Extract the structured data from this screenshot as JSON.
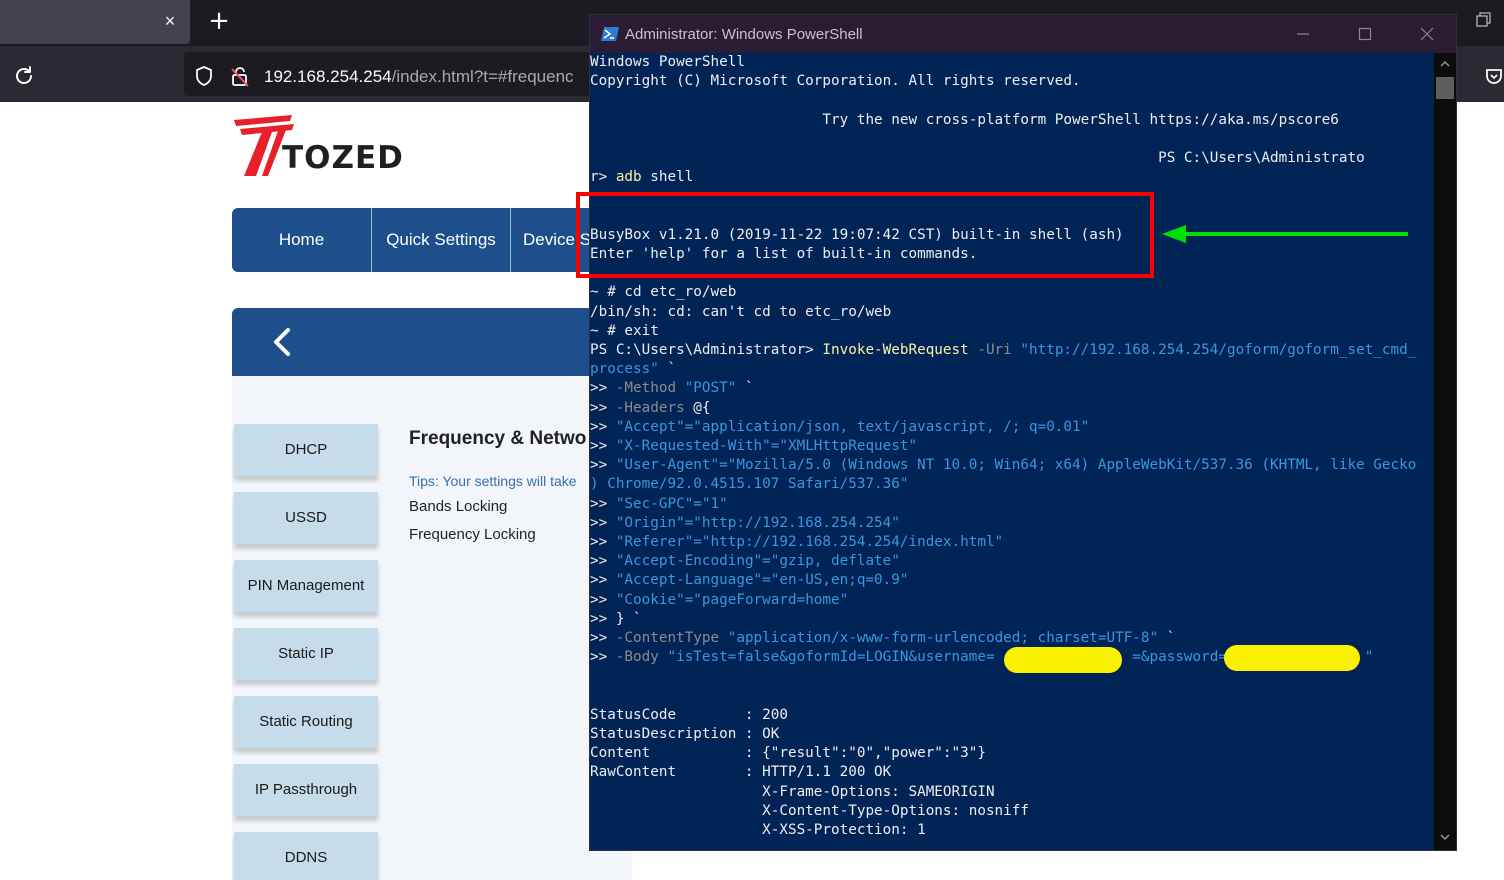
{
  "browser": {
    "tab_close_glyph": "×",
    "new_tab_glyph": "+",
    "url": {
      "host": "192.168.254.254",
      "path": "/index.html?t=#frequenc"
    }
  },
  "site": {
    "logo_text": "TOZED",
    "nav": [
      "Home",
      "Quick Settings",
      "Device S"
    ],
    "sidebar": [
      "DHCP",
      "USSD",
      "PIN Management",
      "Static IP",
      "Static Routing",
      "IP Passthrough",
      "DDNS"
    ],
    "content": {
      "title": "Frequency & Netwo",
      "tips": "Tips: Your settings will take",
      "links": [
        "Bands Locking",
        "Frequency Locking"
      ]
    }
  },
  "powershell": {
    "title": "Administrator: Windows PowerShell",
    "lines": [
      "Windows PowerShell",
      "Copyright (C) Microsoft Corporation. All rights reserved.",
      "",
      "                           Try the new cross-platform PowerShell https://aka.ms/pscore6",
      "",
      "                                                                  PS C:\\Users\\Administrato",
      "r> adb shell",
      "",
      "",
      "BusyBox v1.21.0 (2019-11-22 19:07:42 CST) built-in shell (ash)",
      "Enter 'help' for a list of built-in commands.",
      "",
      "~ # cd etc_ro/web",
      "/bin/sh: cd: can't cd to etc_ro/web",
      "~ # exit",
      "PS C:\\Users\\Administrator> Invoke-WebRequest -Uri \"http://192.168.254.254/goform/goform_set_cmd_",
      "process\" `",
      ">> -Method \"POST\" `",
      ">> -Headers @{",
      ">> \"Accept\"=\"application/json, text/javascript, /; q=0.01\"",
      ">> \"X-Requested-With\"=\"XMLHttpRequest\"",
      ">> \"User-Agent\"=\"Mozilla/5.0 (Windows NT 10.0; Win64; x64) AppleWebKit/537.36 (KHTML, like Gecko",
      ") Chrome/92.0.4515.107 Safari/537.36\"",
      ">> \"Sec-GPC\"=\"1\"",
      ">> \"Origin\"=\"http://192.168.254.254\"",
      ">> \"Referer\"=\"http://192.168.254.254/index.html\"",
      ">> \"Accept-Encoding\"=\"gzip, deflate\"",
      ">> \"Accept-Language\"=\"en-US,en;q=0.9\"",
      ">> \"Cookie\"=\"pageForward=home\"",
      ">> } `",
      ">> -ContentType \"application/x-www-form-urlencoded; charset=UTF-8\" `",
      ">> -Body \"isTest=false&goformId=LOGIN&username=                =&password=                \"",
      "",
      "",
      "StatusCode        : 200",
      "StatusDescription : OK",
      "Content           : {\"result\":\"0\",\"power\":\"3\"}",
      "RawContent        : HTTP/1.1 200 OK",
      "                    X-Frame-Options: SAMEORIGIN",
      "                    X-Content-Type-Options: nosniff",
      "                    X-XSS-Protection: 1"
    ]
  },
  "colors": {
    "ps_background": "#012456",
    "ps_text": "#eeedf0",
    "ps_command_yellow": "#f9f1a5",
    "ps_param_gray": "#8b8b8b",
    "ps_string_cyan": "#3a96dd",
    "site_blue": "#1e4f8c",
    "sidebar_button": "#c6dcea",
    "highlight_red": "#ff0000",
    "arrow_green": "#00e000",
    "redaction_yellow": "#f9f100"
  },
  "icons": [
    "close-icon",
    "plus-icon",
    "reload-icon",
    "shield-icon",
    "lock-icon",
    "pocket-icon",
    "restore-icon",
    "chevron-left-icon",
    "powershell-icon",
    "minimize-icon",
    "maximize-icon",
    "scroll-up-icon",
    "scroll-down-icon",
    "arrow-left-icon"
  ]
}
